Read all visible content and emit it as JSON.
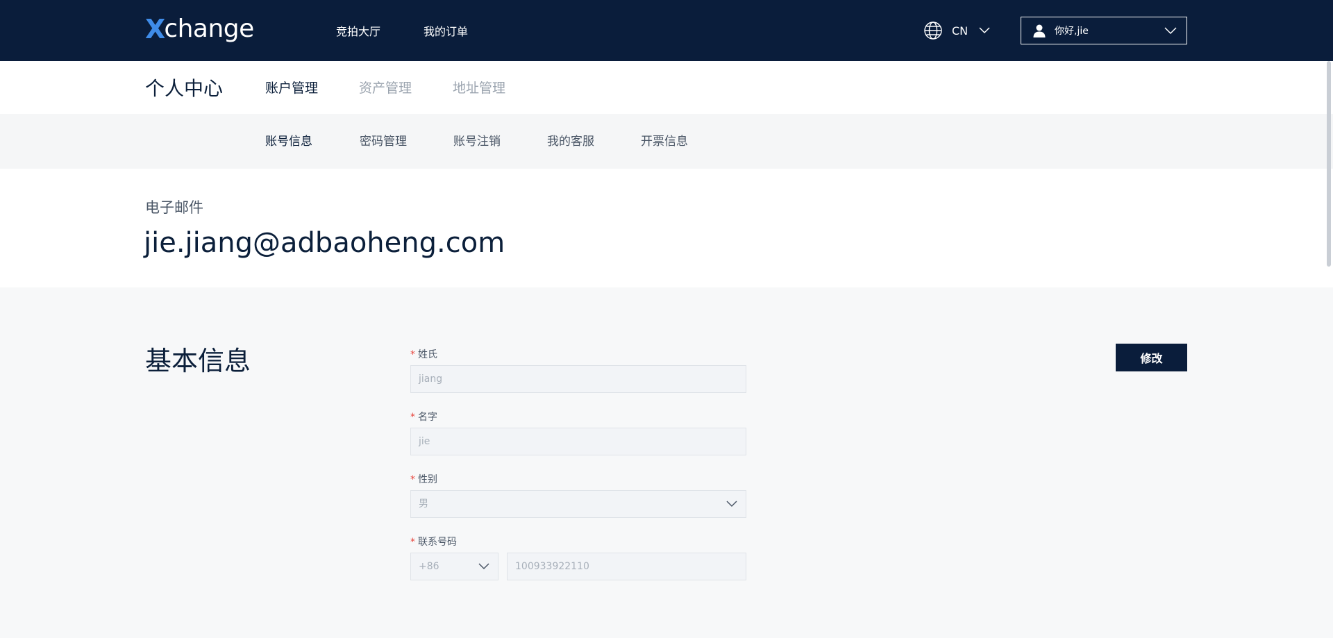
{
  "header": {
    "logo_x": "X",
    "logo_rest": "change",
    "nav": [
      "竞拍大厅",
      "我的订单"
    ],
    "language": "CN",
    "greeting": "你好,jie"
  },
  "primary": {
    "title": "个人中心",
    "tabs": [
      {
        "label": "账户管理",
        "active": true
      },
      {
        "label": "资产管理",
        "active": false
      },
      {
        "label": "地址管理",
        "active": false
      }
    ]
  },
  "secondary": {
    "tabs": [
      {
        "label": "账号信息",
        "active": true
      },
      {
        "label": "密码管理",
        "active": false
      },
      {
        "label": "账号注销",
        "active": false
      },
      {
        "label": "我的客服",
        "active": false
      },
      {
        "label": "开票信息",
        "active": false
      }
    ]
  },
  "email": {
    "label": "电子邮件",
    "value": "jie.jiang@adbaoheng.com"
  },
  "basic_info": {
    "title": "基本信息",
    "edit_label": "修改",
    "required_mark": "*",
    "fields": {
      "surname": {
        "label": "姓氏",
        "value": "jiang"
      },
      "given_name": {
        "label": "名字",
        "value": "jie"
      },
      "gender": {
        "label": "性别",
        "value": "男"
      },
      "phone": {
        "label": "联系号码",
        "country_code": "+86",
        "value": "100933922110"
      }
    }
  },
  "colors": {
    "header_bg": "#0a1d3b",
    "logo_accent": "#3f8ce8",
    "required": "#e8473f",
    "page_bg": "#f7f8f9"
  },
  "icons": {
    "language": "globe-icon",
    "user": "user-icon",
    "dropdown": "chevron-down-icon"
  }
}
